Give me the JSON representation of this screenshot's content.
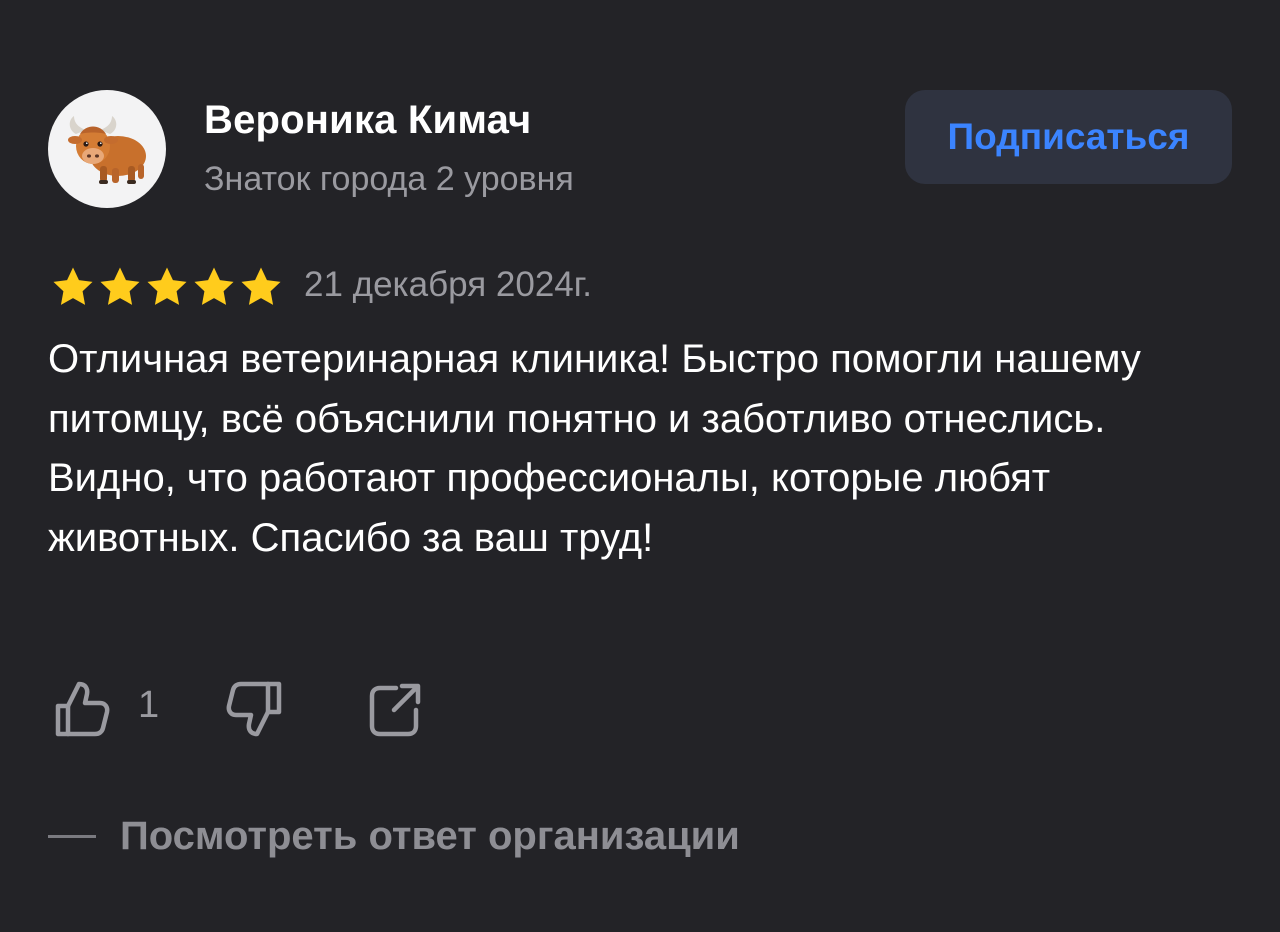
{
  "review": {
    "author": {
      "name": "Вероника Кимач",
      "level": "Знаток города 2 уровня",
      "avatar_icon": "yak-icon"
    },
    "subscribe_label": "Подписаться",
    "rating": {
      "value": 5,
      "max": 5,
      "star_color": "#ffcc1c"
    },
    "date": "21 декабря 2024г.",
    "text": "Отличная ветеринарная клиника! Быстро помогли нашему питомцу, всё объяснили понятно и заботливо отнеслись. Видно, что работают профессионалы, которые любят животных. Спасибо за ваш труд!",
    "actions": {
      "like_icon": "thumbs-up-icon",
      "like_count": "1",
      "dislike_icon": "thumbs-down-icon",
      "share_icon": "share-icon"
    },
    "show_reply_label": "Посмотреть ответ организации"
  },
  "theme": {
    "background": "#232327",
    "accent": "#3b84ff",
    "button_background": "#2f3340",
    "secondary_text": "#9a9aa0"
  }
}
